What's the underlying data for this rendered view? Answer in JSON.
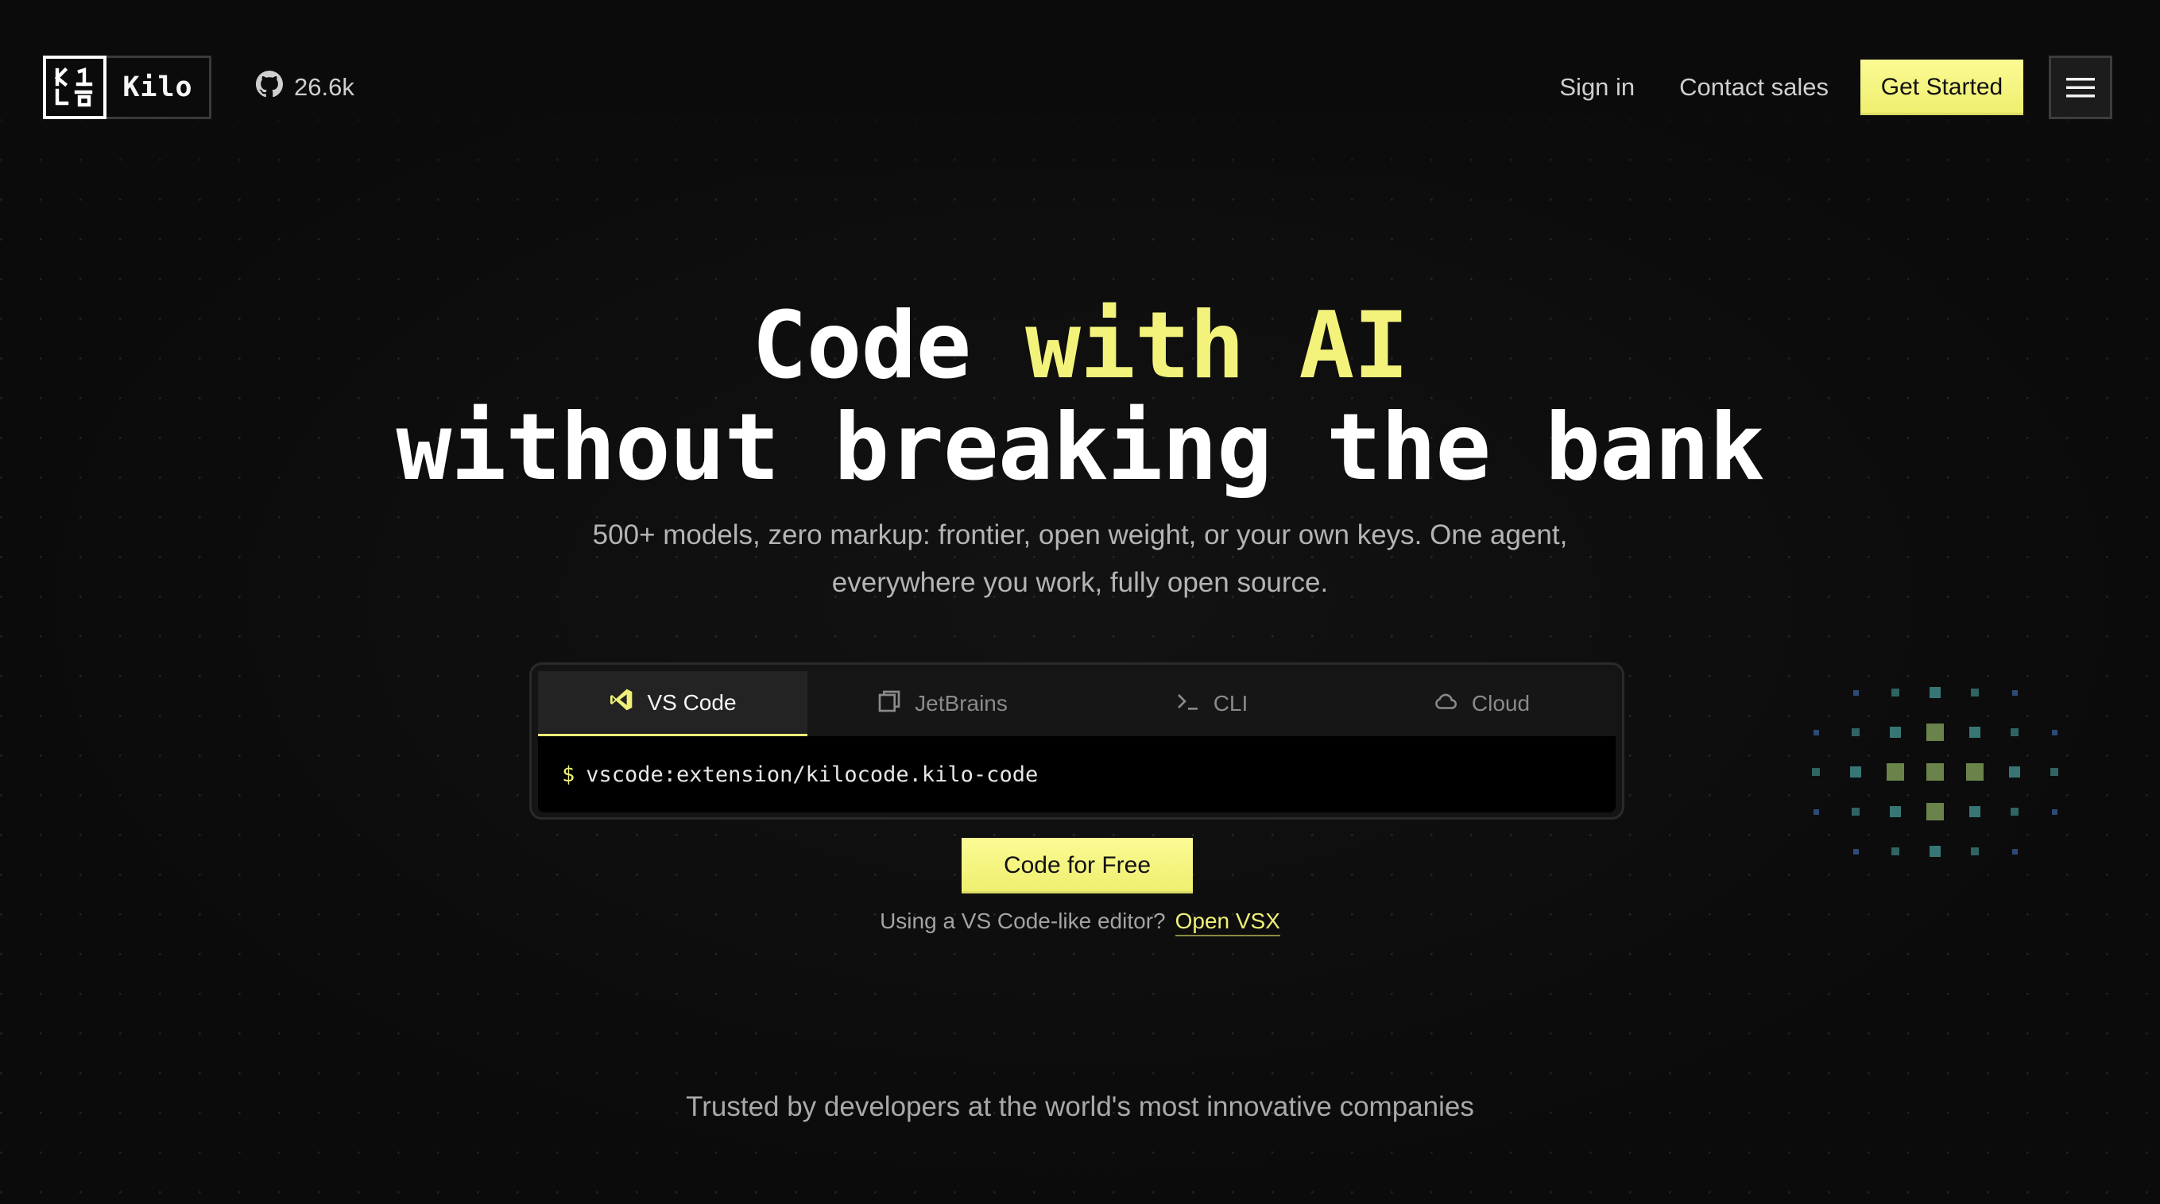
{
  "nav": {
    "brand": "Kilo",
    "github_stars": "26.6k",
    "sign_in": "Sign in",
    "contact_sales": "Contact sales",
    "get_started": "Get Started"
  },
  "hero": {
    "title_part1": "Code ",
    "title_accent": "with AI",
    "title_line2": "without breaking the bank",
    "subtitle_line1": "500+ models, zero markup: frontier, open weight, or your own keys. One agent,",
    "subtitle_line2": "everywhere you work, fully open source."
  },
  "install": {
    "tabs": [
      {
        "label": "VS Code",
        "icon": "vscode-icon",
        "active": true
      },
      {
        "label": "JetBrains",
        "icon": "jetbrains-icon",
        "active": false
      },
      {
        "label": "CLI",
        "icon": "terminal-icon",
        "active": false
      },
      {
        "label": "Cloud",
        "icon": "cloud-icon",
        "active": false
      }
    ],
    "prompt": "$",
    "command": "vscode:extension/kilocode.kilo-code"
  },
  "cta": {
    "primary": "Code for Free",
    "alt_text": "Using a VS Code-like editor?",
    "alt_link": "Open VSX"
  },
  "trusted": {
    "text": "Trusted by developers at the world's most innovative companies"
  },
  "colors": {
    "accent": "#f3f37c",
    "background": "#0b0b0b",
    "cluster_green": "#6f8a4f",
    "cluster_teal": "#3f8a88",
    "cluster_blue": "#3a5f9a"
  }
}
